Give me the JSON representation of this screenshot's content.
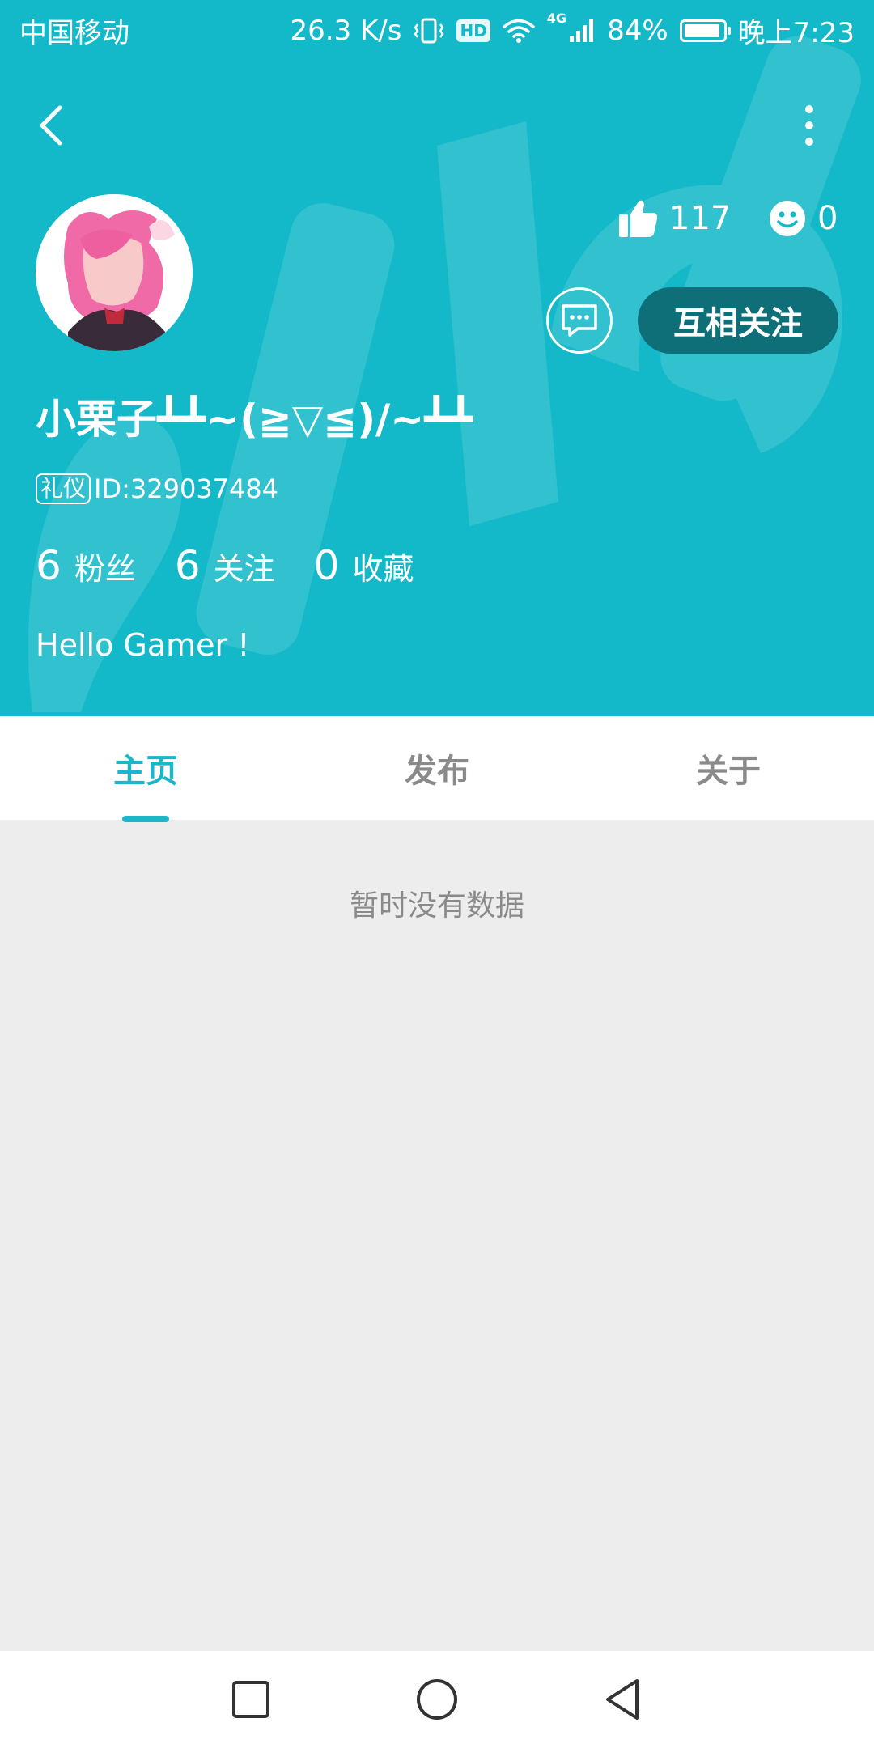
{
  "status_bar": {
    "carrier": "中国移动",
    "speed": "26.3 K/s",
    "hd": "HD",
    "network": "4G",
    "battery": "84%",
    "time": "晚上7:23"
  },
  "profile": {
    "likes": "117",
    "smiles": "0",
    "follow_label": "互相关注",
    "username": "小栗子┻┻~(≧▽≦)/~┻┻",
    "badge": "礼仪",
    "id_text": "ID:329037484",
    "bio": "Hello Gamer !"
  },
  "counts": [
    {
      "value": "6",
      "label": "粉丝"
    },
    {
      "value": "6",
      "label": "关注"
    },
    {
      "value": "0",
      "label": "收藏"
    }
  ],
  "tabs": [
    {
      "label": "主页",
      "active": true
    },
    {
      "label": "发布",
      "active": false
    },
    {
      "label": "关于",
      "active": false
    }
  ],
  "empty_message": "暂时没有数据",
  "colors": {
    "primary": "#14b9c9",
    "follow_button": "#0e6f79",
    "tab_active": "#1bb6c7"
  }
}
